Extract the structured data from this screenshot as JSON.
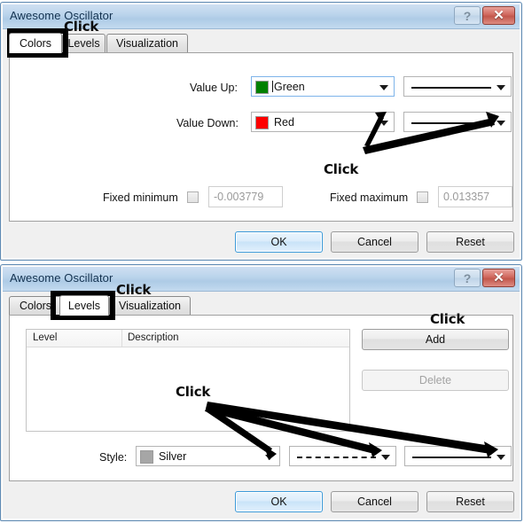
{
  "window_title": "Awesome Oscillator",
  "window_buttons": {
    "help": "?",
    "close": "✕"
  },
  "colors_dialog": {
    "tabs": [
      {
        "label": "Colors",
        "selected": true
      },
      {
        "label": "Levels",
        "selected": false
      },
      {
        "label": "Visualization",
        "selected": false
      }
    ],
    "value_up": {
      "label": "Value Up:",
      "color_name": "Green",
      "color_hex": "#008000",
      "width_preview": "solid"
    },
    "value_down": {
      "label": "Value Down:",
      "color_name": "Red",
      "color_hex": "#FF0000",
      "width_preview": "solid"
    },
    "fixed_minimum": {
      "label": "Fixed minimum",
      "checked": false,
      "value": "-0.003779"
    },
    "fixed_maximum": {
      "label": "Fixed maximum",
      "checked": false,
      "value": "0.013357"
    },
    "buttons": {
      "ok": "OK",
      "cancel": "Cancel",
      "reset": "Reset"
    }
  },
  "levels_dialog": {
    "tabs": [
      {
        "label": "Colors",
        "selected": false
      },
      {
        "label": "Levels",
        "selected": true
      },
      {
        "label": "Visualization",
        "selected": false
      }
    ],
    "list": {
      "columns": [
        "Level",
        "Description"
      ],
      "rows": []
    },
    "add_button": "Add",
    "delete_button": "Delete",
    "style": {
      "label": "Style:",
      "color_name": "Silver",
      "color_hex": "#A6A6A6",
      "dash_preview": "dashed",
      "width_preview": "solid"
    },
    "buttons": {
      "ok": "OK",
      "cancel": "Cancel",
      "reset": "Reset"
    }
  },
  "annotations": {
    "click_label": "Click",
    "top_tab_click": "Click",
    "top_combo_click": "Click",
    "bottom_tab_click": "Click",
    "bottom_add_click": "Click",
    "bottom_style_click": "Click",
    "highlight_color": "#000000"
  }
}
